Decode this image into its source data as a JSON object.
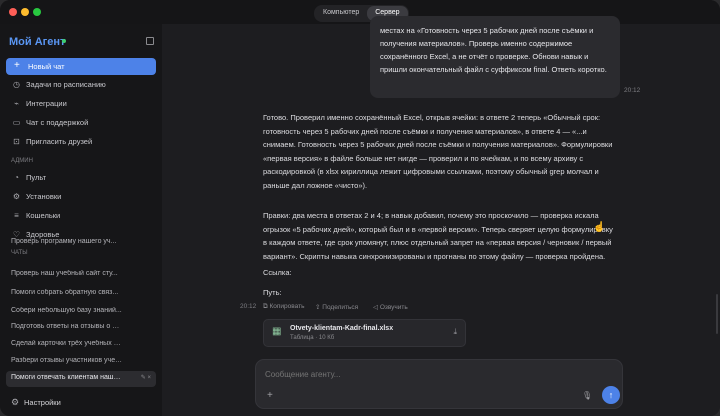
{
  "titlebar": {
    "tabs": [
      {
        "label": "Компьютер",
        "active": false
      },
      {
        "label": "Сервер",
        "active": true
      }
    ]
  },
  "sidebar": {
    "brand": "Мой Агент",
    "new_chat": "Новый чат",
    "items": [
      {
        "label": "Задачи по расписанию",
        "icon": "clock-icon"
      },
      {
        "label": "Интеграции",
        "icon": "plug-icon"
      },
      {
        "label": "Чат с поддержкой",
        "icon": "chat-icon"
      },
      {
        "label": "Пригласить друзей",
        "icon": "gift-icon"
      }
    ],
    "admin_label": "АДМИН",
    "admin_items": [
      {
        "label": "Пульт",
        "icon": "dashboard-icon"
      },
      {
        "label": "Установки",
        "icon": "settings-icon"
      },
      {
        "label": "Кошельки",
        "icon": "wallet-icon"
      },
      {
        "label": "Здоровье",
        "icon": "health-icon"
      }
    ],
    "chats_label": "ЧАТЫ",
    "chats": [
      "Проверь программу нашего уч...",
      "Проверь наш учебный сайт сту...",
      "Помоги собрать обратную связ...",
      "Собери небольшую базу знаний...",
      "Подготовь ответы на отзывы о наш...",
      "Сделай карточки трёх учебных тов...",
      "Разбери отзывы участников учебн...",
      "Помоги отвечать клиентам нашей ..."
    ],
    "active_chat_index": 7,
    "settings": "Настройки"
  },
  "conversation": {
    "user_message": "местах на «Готовность через 5 рабочих дней после съёмки и получения материалов». Проверь именно содержимое сохранённого Excel, а не отчёт о проверке. Обнови навык и пришли окончательный файл с суффиксом final. Ответь коротко.",
    "user_time": "20:12",
    "reply_paragraphs": [
      "Готово. Проверил именно сохранённый Excel, открыв ячейки: в ответе 2 теперь «Обычный срок: готовность через 5 рабочих дней после съёмки и получения материалов», в ответе 4 — «...и снимаем. Готовность через 5 рабочих дней после съёмки и получения материалов». Формулировки «первая версия» в файле больше нет нигде — проверил и по ячейкам, и по всему архиву с раскодировкой (в xlsx кириллица лежит цифровыми ссылками, поэтому обычный grep молчал и раньше дал ложное «чисто»).",
      "Правки: два места в ответах 2 и 4; в навык добавил, почему это проскочило — проверка искала огрызок «5 рабочих дней», который был и в «первой версии». Теперь сверяет целую формулировку в каждом ответе, где срок упомянут, плюс отдельный запрет на «первая версия / черновик / первый вариант». Скрипты навыка синхронизированы и прогнаны по этому файлу — проверка пройдена.",
      "Ссылка:",
      "Путь:"
    ],
    "reply_time": "20:12",
    "actions": {
      "copy": "Копировать",
      "share": "Поделиться",
      "speak": "Озвучить"
    },
    "file": {
      "name": "Otvety-klientam-Kadr-final.xlsx",
      "meta": "Таблица · 10 Кб"
    }
  },
  "composer": {
    "placeholder": "Сообщение агенту..."
  },
  "colors": {
    "accent": "#4d82e8",
    "online": "#3ecf6e",
    "brand": "#5a96f2"
  }
}
